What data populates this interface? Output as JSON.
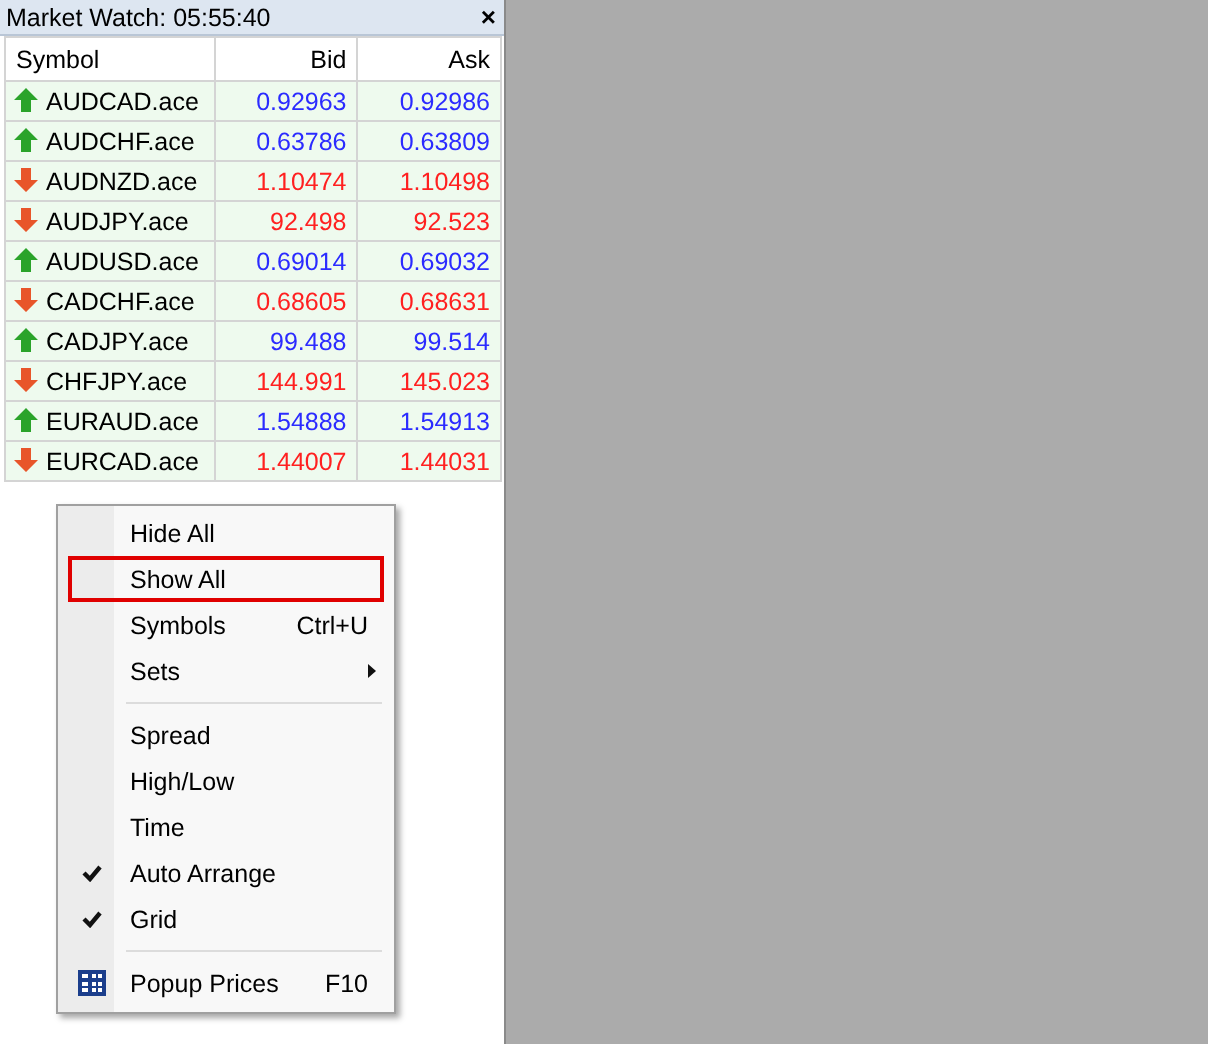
{
  "window": {
    "title": "Market Watch: 05:55:40",
    "close": "×"
  },
  "table": {
    "columns": [
      "Symbol",
      "Bid",
      "Ask"
    ],
    "rows": [
      {
        "symbol": "AUDCAD.ace",
        "bid": "0.92963",
        "ask": "0.92986",
        "kind": "up"
      },
      {
        "symbol": "AUDCHF.ace",
        "bid": "0.63786",
        "ask": "0.63809",
        "kind": "up"
      },
      {
        "symbol": "AUDNZD.ace",
        "bid": "1.10474",
        "ask": "1.10498",
        "kind": "down"
      },
      {
        "symbol": "AUDJPY.ace",
        "bid": "92.498",
        "ask": "92.523",
        "kind": "down"
      },
      {
        "symbol": "AUDUSD.ace",
        "bid": "0.69014",
        "ask": "0.69032",
        "kind": "up"
      },
      {
        "symbol": "CADCHF.ace",
        "bid": "0.68605",
        "ask": "0.68631",
        "kind": "down"
      },
      {
        "symbol": "CADJPY.ace",
        "bid": "99.488",
        "ask": "99.514",
        "kind": "up"
      },
      {
        "symbol": "CHFJPY.ace",
        "bid": "144.991",
        "ask": "145.023",
        "kind": "down"
      },
      {
        "symbol": "EURAUD.ace",
        "bid": "1.54888",
        "ask": "1.54913",
        "kind": "up"
      },
      {
        "symbol": "EURCAD.ace",
        "bid": "1.44007",
        "ask": "1.44031",
        "kind": "down"
      }
    ]
  },
  "context_menu": {
    "items": [
      {
        "kind": "item",
        "label": "Hide All",
        "checked": false,
        "highlighted": false,
        "submenu": false
      },
      {
        "kind": "item",
        "label": "Show All",
        "checked": false,
        "highlighted": true,
        "submenu": false
      },
      {
        "kind": "item",
        "label": "Symbols",
        "shortcut": "Ctrl+U",
        "checked": false,
        "highlighted": false,
        "submenu": false
      },
      {
        "kind": "item",
        "label": "Sets",
        "checked": false,
        "highlighted": false,
        "submenu": true
      },
      {
        "kind": "separator"
      },
      {
        "kind": "item",
        "label": "Spread",
        "checked": false,
        "highlighted": false,
        "submenu": false
      },
      {
        "kind": "item",
        "label": "High/Low",
        "checked": false,
        "highlighted": false,
        "submenu": false
      },
      {
        "kind": "item",
        "label": "Time",
        "checked": false,
        "highlighted": false,
        "submenu": false
      },
      {
        "kind": "item",
        "label": "Auto Arrange",
        "checked": true,
        "highlighted": false,
        "submenu": false
      },
      {
        "kind": "item",
        "label": "Grid",
        "checked": true,
        "highlighted": false,
        "submenu": false
      },
      {
        "kind": "separator"
      },
      {
        "kind": "item",
        "label": "Popup Prices",
        "shortcut": "F10",
        "icon": true,
        "checked": false,
        "highlighted": false,
        "submenu": false
      }
    ]
  }
}
